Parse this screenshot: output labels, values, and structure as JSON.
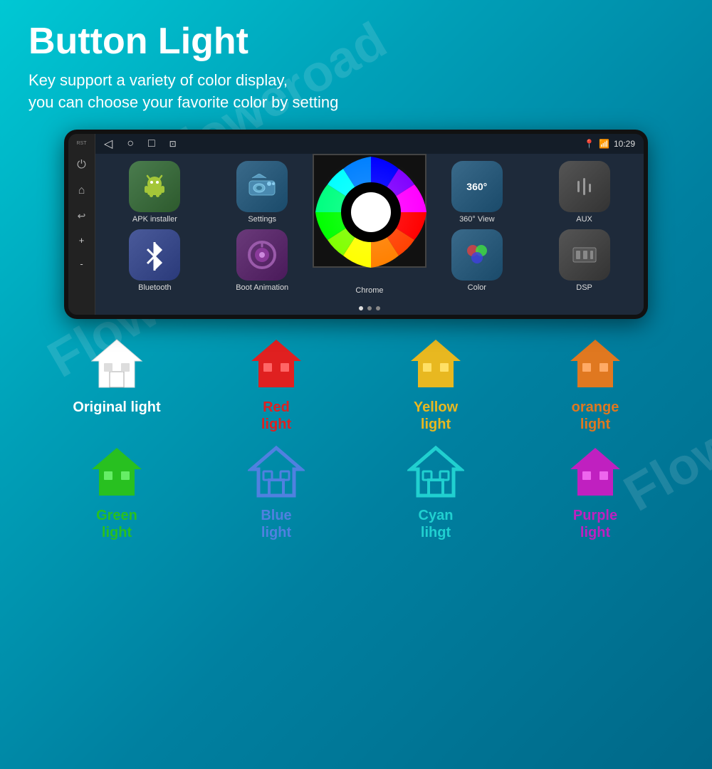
{
  "title": "Button Light",
  "subtitle_line1": "Key support a variety of color display,",
  "subtitle_line2": "you can choose your favorite color by setting",
  "screen": {
    "time": "10:29",
    "nav_icons": [
      "◁",
      "○",
      "□",
      "⊡"
    ],
    "apps": [
      {
        "id": "apk-installer",
        "label": "APK installer",
        "icon": "🤖",
        "bg": "apk-bg"
      },
      {
        "id": "settings",
        "label": "Settings",
        "icon": "🚗",
        "bg": "settings-bg"
      },
      {
        "id": "view360",
        "label": "360° View",
        "icon": "360°",
        "bg": "view360-bg"
      },
      {
        "id": "aux",
        "label": "AUX",
        "icon": "⚙",
        "bg": "aux-bg"
      },
      {
        "id": "bluetooth",
        "label": "Bluetooth",
        "icon": "⚡",
        "bg": "bluetooth-bg"
      },
      {
        "id": "boot-animation",
        "label": "Boot Animation",
        "icon": "⏻",
        "bg": "bootanim-bg"
      },
      {
        "id": "chrome",
        "label": "Chrome",
        "icon": "🎨",
        "bg": "chrome-bg"
      },
      {
        "id": "color",
        "label": "Color",
        "icon": "🎨",
        "bg": "color-bg"
      },
      {
        "id": "dsp",
        "label": "DSP",
        "icon": "⚙",
        "bg": "dsp-bg"
      }
    ],
    "side_buttons": [
      {
        "id": "rst",
        "label": "RST"
      },
      {
        "id": "power",
        "label": "⏻"
      },
      {
        "id": "home",
        "label": "⌂"
      },
      {
        "id": "back",
        "label": "↩"
      },
      {
        "id": "vol-up",
        "label": "▲"
      },
      {
        "id": "vol-down",
        "label": "▼"
      }
    ]
  },
  "lights": [
    {
      "id": "original",
      "label": "Original\nlight",
      "color": "white",
      "hex": "#ffffff"
    },
    {
      "id": "red",
      "label": "Red\nlight",
      "color": "red",
      "hex": "#e02020"
    },
    {
      "id": "yellow",
      "label": "Yellow\nlight",
      "color": "yellow",
      "hex": "#e8b820"
    },
    {
      "id": "orange",
      "label": "orange\nlight",
      "color": "orange",
      "hex": "#e07820"
    },
    {
      "id": "green",
      "label": "Green\nlight",
      "color": "green",
      "hex": "#28c020"
    },
    {
      "id": "blue",
      "label": "Blue\nlight",
      "color": "blue",
      "hex": "#5080e0"
    },
    {
      "id": "cyan",
      "label": "Cyan\nlihgt",
      "color": "cyan",
      "hex": "#20d0d0"
    },
    {
      "id": "purple",
      "label": "Purple\nlight",
      "color": "purple",
      "hex": "#c020c0"
    }
  ],
  "watermarks": [
    "Floweroad",
    "Floweroad",
    "Flower"
  ]
}
